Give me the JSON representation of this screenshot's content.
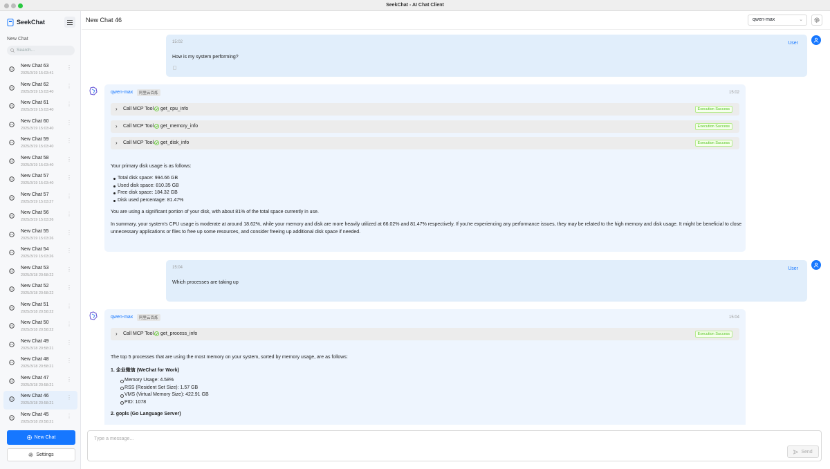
{
  "window": {
    "title": "SeekChat - AI Chat Client"
  },
  "sidebar": {
    "brand": "SeekChat",
    "section_label": "New Chat",
    "search_placeholder": "Search...",
    "chats": [
      {
        "title": "New Chat 63",
        "time": "2025/3/19 15:03:41"
      },
      {
        "title": "New Chat 62",
        "time": "2025/3/19 15:03:40"
      },
      {
        "title": "New Chat 61",
        "time": "2025/3/19 15:03:40"
      },
      {
        "title": "New Chat 60",
        "time": "2025/3/19 15:03:40"
      },
      {
        "title": "New Chat 59",
        "time": "2025/3/19 15:03:40"
      },
      {
        "title": "New Chat 58",
        "time": "2025/3/19 15:03:40"
      },
      {
        "title": "New Chat 57",
        "time": "2025/3/19 15:03:40"
      },
      {
        "title": "New Chat 57",
        "time": "2025/3/19 15:03:27"
      },
      {
        "title": "New Chat 56",
        "time": "2025/3/19 15:03:26"
      },
      {
        "title": "New Chat 55",
        "time": "2025/3/19 15:03:26"
      },
      {
        "title": "New Chat 54",
        "time": "2025/3/19 15:03:26"
      },
      {
        "title": "New Chat 53",
        "time": "2025/3/18 20:58:22"
      },
      {
        "title": "New Chat 52",
        "time": "2025/3/18 20:58:22"
      },
      {
        "title": "New Chat 51",
        "time": "2025/3/18 20:58:22"
      },
      {
        "title": "New Chat 50",
        "time": "2025/3/18 20:58:22"
      },
      {
        "title": "New Chat 49",
        "time": "2025/3/18 20:58:21"
      },
      {
        "title": "New Chat 48",
        "time": "2025/3/18 20:58:21"
      },
      {
        "title": "New Chat 47",
        "time": "2025/3/18 20:58:21"
      },
      {
        "title": "New Chat 46",
        "time": "2025/3/18 20:58:21",
        "active": true
      },
      {
        "title": "New Chat 45",
        "time": "2025/3/18 20:58:21"
      }
    ],
    "new_chat_label": "New Chat",
    "settings_label": "Settings"
  },
  "header": {
    "title": "New Chat 46",
    "model": "qwen-max"
  },
  "messages": {
    "m1": {
      "role": "User",
      "time": "15:02",
      "text": "How is my system performing?"
    },
    "m2": {
      "model": "qwen-max",
      "provider": "阿里云百炼",
      "time": "15:02",
      "tool_prefix": "Call MCP Tool",
      "tools": [
        {
          "name": "get_cpu_info",
          "status": "Execution Success"
        },
        {
          "name": "get_memory_info",
          "status": "Execution Success"
        },
        {
          "name": "get_disk_info",
          "status": "Execution Success"
        }
      ],
      "intro": "Your primary disk usage is as follows:",
      "bullets": [
        "Total disk space: 994.66 GB",
        "Used disk space: 810.35 GB",
        "Free disk space: 184.32 GB",
        "Disk used percentage: 81.47%"
      ],
      "para1": "You are using a significant portion of your disk, with about 81% of the total space currently in use.",
      "para2_line1": "In summary, your system's CPU usage is moderate at around 18.62%, while your memory and disk are more heavily utilized at 66.02% and 81.47% respectively. If you're experiencing any performance issues, they may be related to the high memory and disk usage. It might be beneficial to close",
      "para2_line2": "unnecessary applications or files to free up some resources, and consider freeing up additional disk space if needed."
    },
    "m3": {
      "role": "User",
      "time": "15:04",
      "text": "Which processes are taking up"
    },
    "m4": {
      "model": "qwen-max",
      "provider": "阿里云百炼",
      "time": "15:04",
      "tool_prefix": "Call MCP Tool",
      "tool": {
        "name": "get_process_info",
        "status": "Execution Success"
      },
      "intro": "The top 5 processes that are using the most memory on your system, sorted by memory usage, are as follows:",
      "item1_title": "1. 企业微信 (WeChat for Work)",
      "item1_details": [
        "Memory Usage: 4.58%",
        "RSS (Resident Set Size): 1.57 GB",
        "VMS (Virtual Memory Size): 422.91 GB",
        "PID: 1078"
      ],
      "item2_title": "2. gopls (Go Language Server)"
    }
  },
  "composer": {
    "placeholder": "Type a message...",
    "send_label": "Send"
  },
  "colors": {
    "accent": "#1677ff",
    "success": "#52c41a",
    "user_bubble": "#e1eefb",
    "ai_bubble": "#eef5fe"
  }
}
